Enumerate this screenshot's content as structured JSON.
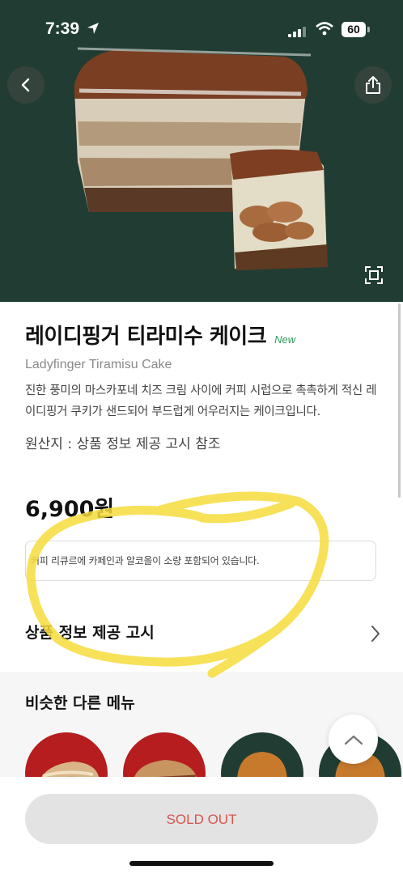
{
  "status_bar": {
    "time": "7:39",
    "battery": "60"
  },
  "product": {
    "name": "레이디핑거 티라미수 케이크",
    "badge": "New",
    "name_en": "Ladyfinger Tiramisu Cake",
    "description": "진한 풍미의 마스카포네 치즈 크림 사이에 커피 시럽으로 촉촉하게 적신 레이디핑거 쿠키가 샌드되어 부드럽게 어우러지는 케이크입니다.",
    "origin": "원산지 : 상품 정보 제공 고시 참조",
    "price": "6,900원",
    "notice": "커피 리큐르에 카페인과 알코올이 소량 포함되어 있습니다."
  },
  "info_row": {
    "label": "상품 정보 제공 고시"
  },
  "similar": {
    "title": "비슷한 다른 메뉴",
    "items": [
      {
        "icon": "flatbread-sandwich",
        "bg": "#b51d1f"
      },
      {
        "icon": "ciabatta-sandwich",
        "bg": "#b51d1f"
      },
      {
        "icon": "burger",
        "bg": "#213d33"
      },
      {
        "icon": "burger",
        "bg": "#213d33"
      }
    ]
  },
  "bottom": {
    "sold_out_label": "SOLD OUT"
  },
  "colors": {
    "hero_bg": "#213d33",
    "badge_green": "#2e9e5b",
    "sold_out_text": "#d9534f",
    "highlight_yellow": "#f6dc3c"
  }
}
